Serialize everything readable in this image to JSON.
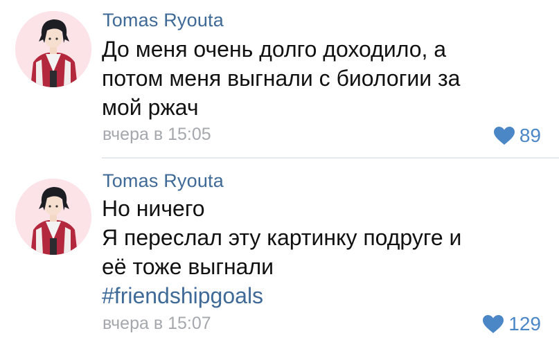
{
  "comments": [
    {
      "author": "Tomas Ryouta",
      "lines": [
        "До меня очень долго доходило, а",
        "потом меня выгнали с биологии за",
        "мой ржач"
      ],
      "hashtag": "",
      "time": "вчера в 15:05",
      "likes": "89",
      "avatar_icon": "anime-character-avatar"
    },
    {
      "author": "Tomas Ryouta",
      "lines": [
        "Но ничего",
        "Я переслал эту картинку подруге и",
        "её тоже выгнали"
      ],
      "hashtag": "#friendshipgoals",
      "time": "вчера в 15:07",
      "likes": "129",
      "avatar_icon": "anime-character-avatar"
    }
  ],
  "colors": {
    "author": "#3f6a97",
    "hashtag": "#3f6a97",
    "like": "#4b87c7",
    "time": "#a4a8ad",
    "avatar_bg": "#fbe3e8"
  }
}
